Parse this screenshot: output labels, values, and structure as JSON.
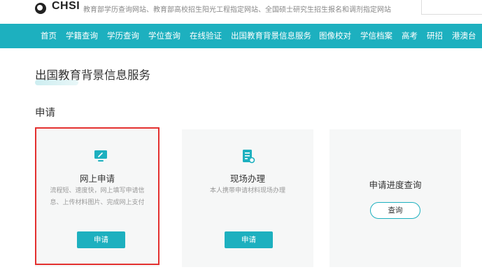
{
  "header": {
    "logo_text": "CHSI",
    "slogan": "教育部学历查询网站、教育部高校招生阳光工程指定网站、全国硕士研究生招生报名和调剂指定网站"
  },
  "nav": {
    "items": [
      "首页",
      "学籍查询",
      "学历查询",
      "学位查询",
      "在线验证",
      "出国教育背景信息服务",
      "图像校对",
      "学信档案",
      "高考",
      "研招",
      "港澳台"
    ]
  },
  "page": {
    "title": "出国教育背景信息服务",
    "section": "申请"
  },
  "cards": {
    "online": {
      "title": "网上申请",
      "desc_line1": "流程短、速度快，网上填写申请信",
      "desc_line2": "息、上传材料图片、完成网上支付",
      "button": "申请"
    },
    "onsite": {
      "title": "现场办理",
      "desc": "本人携带申请材料现场办理",
      "button": "申请"
    },
    "progress": {
      "title": "申请进度查询",
      "button": "查询"
    }
  },
  "colors": {
    "accent": "#1db0bf",
    "highlight": "#e3302f"
  }
}
